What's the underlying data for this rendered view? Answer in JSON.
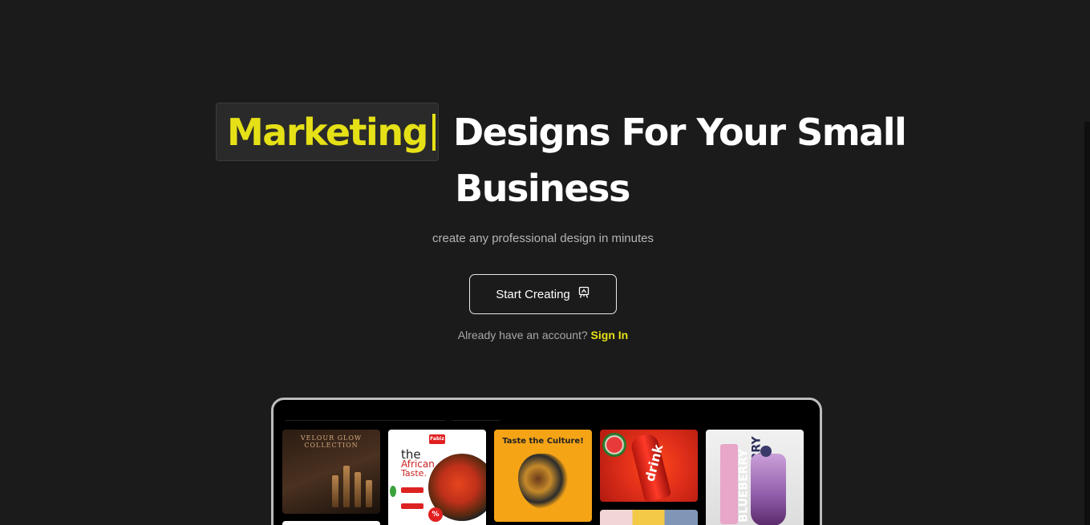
{
  "hero": {
    "highlight_word": "Marketing",
    "headline_rest": "Designs For Your Small",
    "headline_line2": "Business",
    "subtitle": "create any professional design in minutes",
    "cta_label": "Start Creating",
    "signin_prompt": "Already have an account?",
    "signin_link": "Sign In"
  },
  "colors": {
    "background": "#1b1b1b",
    "accent": "#e6e017"
  },
  "preview": {
    "cards": [
      {
        "title": "VELOUR GLOW COLLECTION"
      },
      {
        "brand": "Fabiz",
        "title_line1": "the",
        "title_line2": "African",
        "title_line3": "Taste.",
        "badge": "%"
      },
      {
        "title": "Taste the Culture!"
      },
      {
        "word": "drink"
      },
      {
        "word1": "BLUEBERRY",
        "word2": "BLUEBERRY"
      }
    ]
  }
}
